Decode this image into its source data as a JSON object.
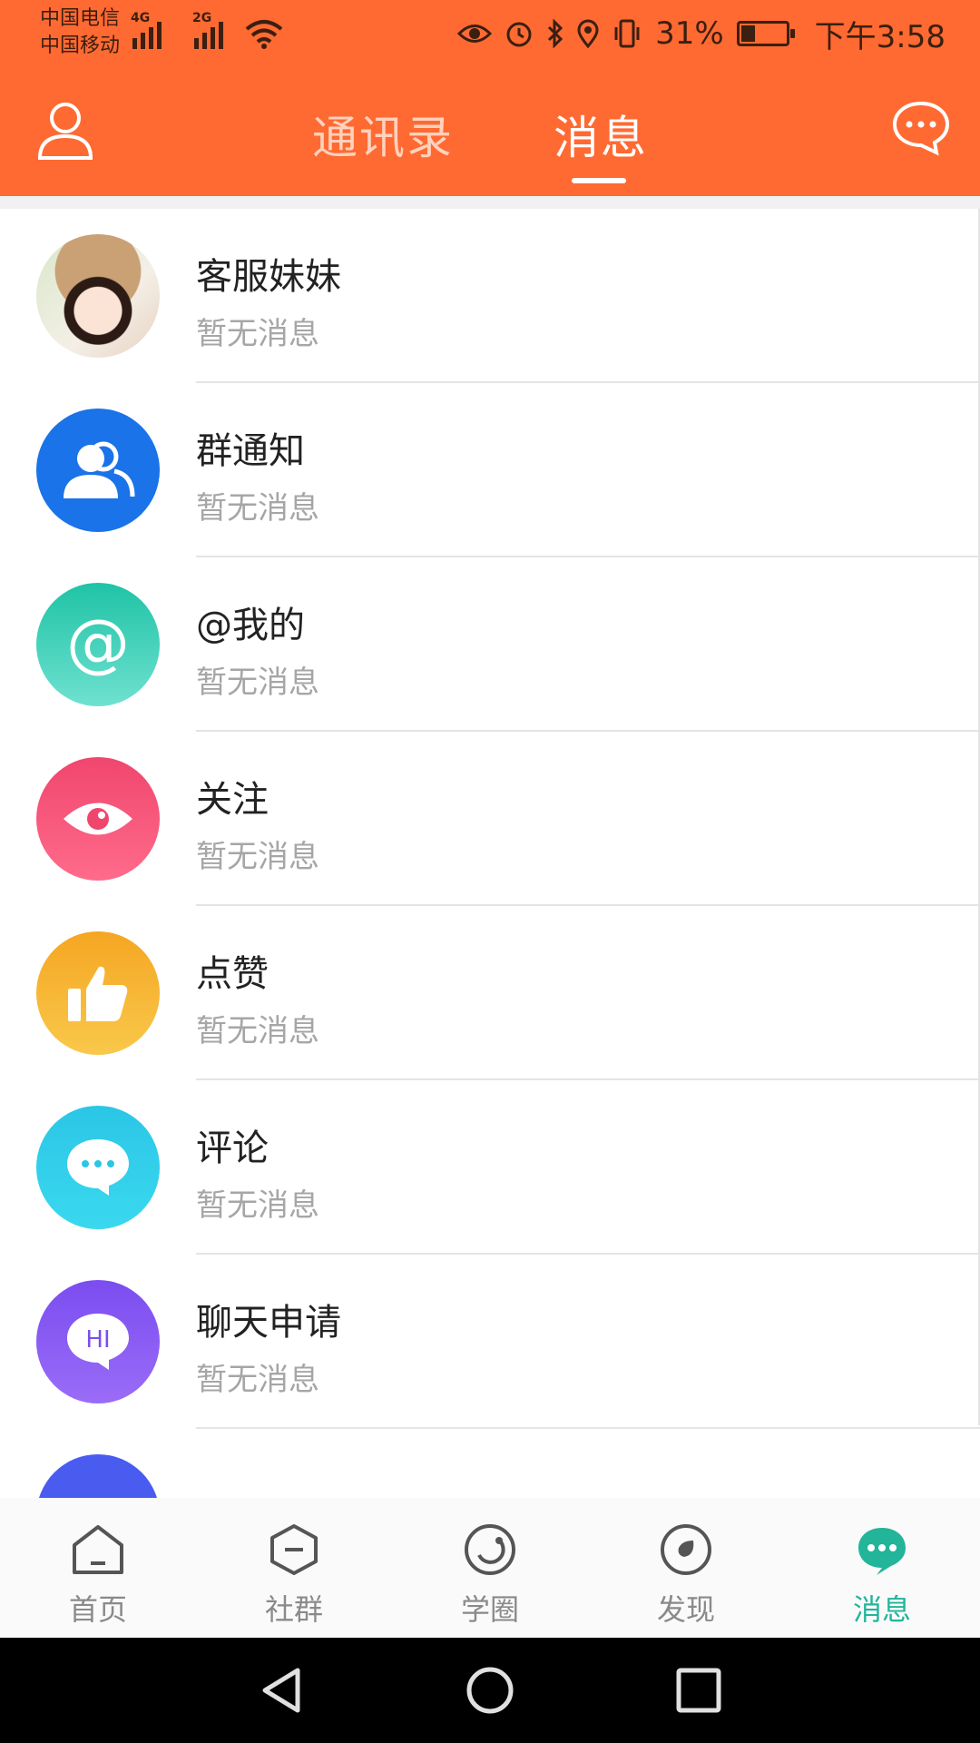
{
  "status_bar": {
    "carriers": [
      "中国电信",
      "中国移动"
    ],
    "signal_tags": [
      "4G",
      "2G"
    ],
    "battery": "31%",
    "time": "下午3:58"
  },
  "header": {
    "tabs": [
      {
        "label": "通讯录",
        "active": false
      },
      {
        "label": "消息",
        "active": true
      }
    ]
  },
  "messages": [
    {
      "title": "客服妹妹",
      "subtitle": "暂无消息",
      "icon": "customer-service-avatar",
      "color": "#e9d8c8"
    },
    {
      "title": "群通知",
      "subtitle": "暂无消息",
      "icon": "group-icon",
      "color": "#1a73e8"
    },
    {
      "title": "@我的",
      "subtitle": "暂无消息",
      "icon": "at-icon",
      "color": "#2fc9b0"
    },
    {
      "title": "关注",
      "subtitle": "暂无消息",
      "icon": "eye-icon",
      "color": "#f0466e"
    },
    {
      "title": "点赞",
      "subtitle": "暂无消息",
      "icon": "thumbs-up-icon",
      "color": "#f5a623"
    },
    {
      "title": "评论",
      "subtitle": "暂无消息",
      "icon": "comment-icon",
      "color": "#2bc6e6"
    },
    {
      "title": "聊天申请",
      "subtitle": "暂无消息",
      "icon": "hi-bubble-icon",
      "color": "#7b4df0"
    }
  ],
  "bottom_nav": [
    {
      "label": "首页",
      "icon": "home-icon",
      "active": false
    },
    {
      "label": "社群",
      "icon": "community-icon",
      "active": false
    },
    {
      "label": "学圈",
      "icon": "circle-icon",
      "active": false
    },
    {
      "label": "发现",
      "icon": "discover-icon",
      "active": false
    },
    {
      "label": "消息",
      "icon": "message-icon",
      "active": true
    }
  ],
  "colors": {
    "accent": "#ff6a32",
    "nav_active": "#22b59a"
  }
}
